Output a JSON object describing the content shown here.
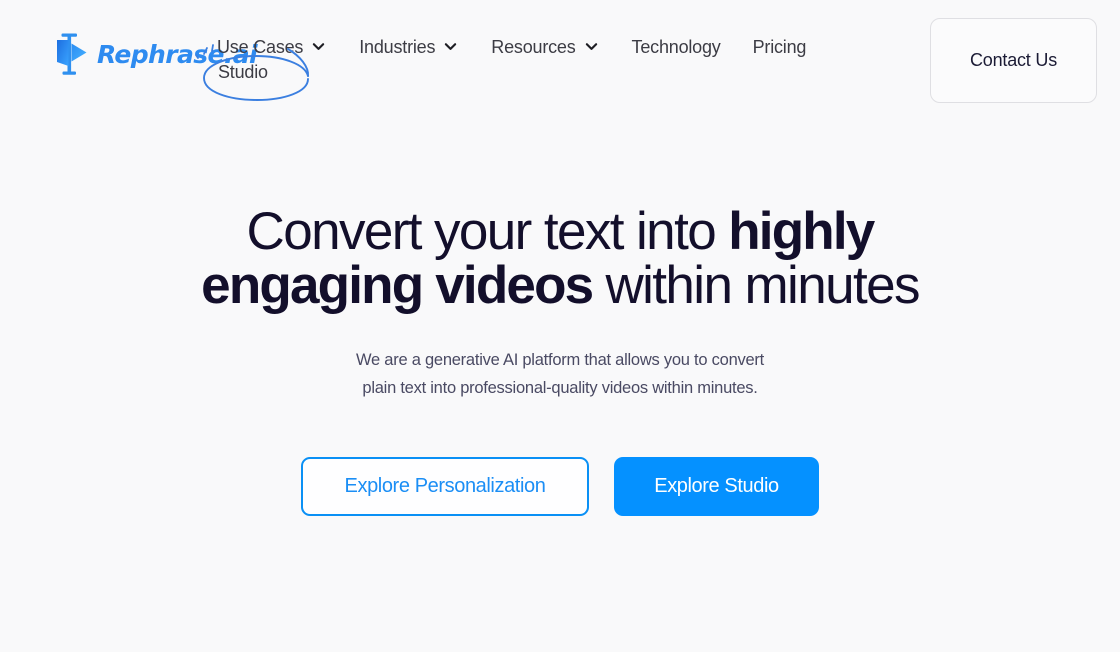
{
  "brand": {
    "name": "Rephrase.ai",
    "logo_icon": "flag-icon",
    "color": "#2e8bf0"
  },
  "nav": {
    "items": [
      {
        "label": "Use Cases",
        "icon": "chevron-down-icon",
        "has_dropdown": true
      },
      {
        "label": "Industries",
        "icon": "chevron-down-icon",
        "has_dropdown": true
      },
      {
        "label": "Resources",
        "icon": "chevron-down-icon",
        "has_dropdown": true
      },
      {
        "label": "Technology",
        "icon": "",
        "has_dropdown": false
      },
      {
        "label": "Pricing",
        "icon": "",
        "has_dropdown": false
      }
    ],
    "contact_button": "Contact Us"
  },
  "annotation": {
    "label": "Studio",
    "shape": "hand-drawn-ellipse",
    "color": "#3b7fe0"
  },
  "hero": {
    "headline": {
      "line1_prefix": "Convert your text into ",
      "line1_bold": "highly",
      "line2_bold": "engaging videos",
      "line2_suffix": " within minutes"
    },
    "subtitle_line1": "We are a generative AI platform that allows you to convert",
    "subtitle_line2": "plain text into professional-quality videos within minutes."
  },
  "cta": {
    "primary_outline": "Explore Personalization",
    "primary_filled": "Explore Studio",
    "accent_color": "#0591ff"
  }
}
